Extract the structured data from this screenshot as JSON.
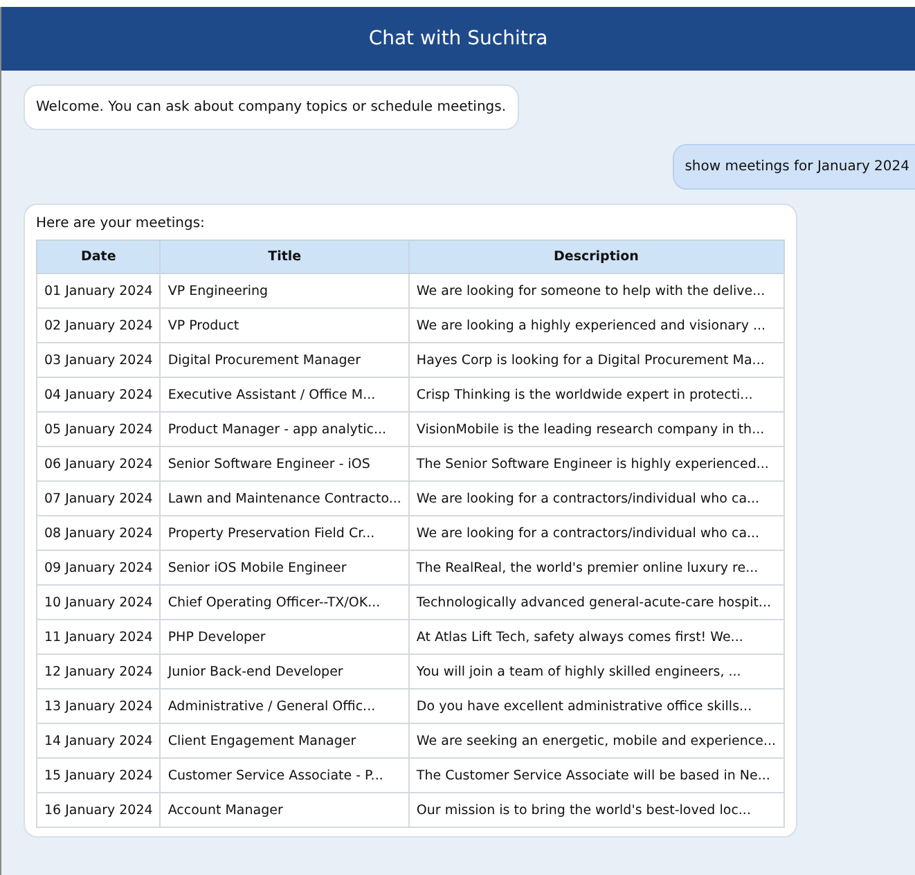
{
  "header": {
    "title": "Chat with Suchitra"
  },
  "messages": [
    {
      "kind": "bot",
      "text": "Welcome. You can ask about company topics or schedule meetings."
    },
    {
      "kind": "user",
      "text": "show meetings for January 2024"
    },
    {
      "kind": "table",
      "intro": "Here are your meetings:",
      "columns": [
        "Date",
        "Title",
        "Description"
      ],
      "rows": [
        [
          "01 January 2024",
          "VP Engineering",
          "We are looking for someone to help with the delive..."
        ],
        [
          "02 January 2024",
          "VP Product",
          "We are looking a highly experienced and visionary ..."
        ],
        [
          "03 January 2024",
          "Digital Procurement Manager",
          "Hayes Corp is looking for a Digital Procurement Ma..."
        ],
        [
          "04 January 2024",
          "Executive Assistant / Office M...",
          "Crisp Thinking is the worldwide expert in protecti..."
        ],
        [
          "05 January 2024",
          "Product Manager - app analytic...",
          "VisionMobile is the leading research company in th..."
        ],
        [
          "06 January 2024",
          "Senior Software Engineer - iOS",
          "The Senior Software Engineer is highly experienced..."
        ],
        [
          "07 January 2024",
          "Lawn and Maintenance Contracto...",
          "We are looking for a contractors/individual who ca..."
        ],
        [
          "08 January 2024",
          "Property Preservation Field Cr...",
          "We are looking for a contractors/individual who ca..."
        ],
        [
          "09 January 2024",
          "Senior iOS Mobile Engineer",
          "The RealReal, the world's premier online luxury re..."
        ],
        [
          "10 January 2024",
          "Chief Operating Officer--TX/OK...",
          "Technologically advanced general-acute-care hospit..."
        ],
        [
          "11 January 2024",
          "PHP Developer",
          "At Atlas Lift Tech, safety always comes first! We..."
        ],
        [
          "12 January 2024",
          "Junior Back-end Developer",
          "You will join a team of highly skilled engineers, ..."
        ],
        [
          "13 January 2024",
          "Administrative / General Offic...",
          "Do you have excellent administrative office skills..."
        ],
        [
          "14 January 2024",
          "Client Engagement Manager",
          "We are seeking an energetic, mobile and experience..."
        ],
        [
          "15 January 2024",
          "Customer Service Associate - P...",
          "The Customer Service Associate will be based in Ne..."
        ],
        [
          "16 January 2024",
          "Account Manager",
          "Our mission is to bring the world's best-loved loc..."
        ]
      ]
    }
  ]
}
